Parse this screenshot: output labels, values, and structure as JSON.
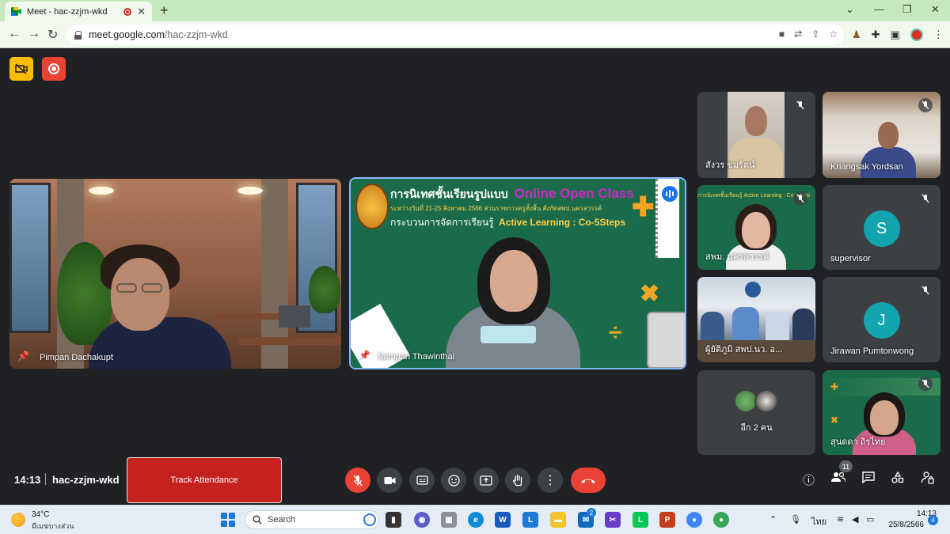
{
  "browser": {
    "tab_title": "Meet - hac-zzjm-wkd",
    "url_host": "meet.google.com",
    "url_path": "/hac-zzjm-wkd"
  },
  "participants": {
    "main_left": {
      "name": "Pimpan Dachakupt"
    },
    "main_center": {
      "name": "Sampan Thawinthai",
      "banner_title_th": "การนิเทศชั้นเรียนรูปแบบ",
      "banner_title_en": "Online Open Class",
      "banner_subtitle_th": "ระหว่างวันที่ 21-25 สิงหาคม 2566 ส่วนราชการครูทั้งสิ้น สังกัดสพป.นครสวรรค์",
      "banner_process_th": "กระบวนการจัดการเรียนรู้",
      "banner_process_en": "Active Learning : Co-5Steps"
    },
    "grid": [
      {
        "name": "สังวร ขมรัตน์",
        "muted": true
      },
      {
        "name": "Kriangsak Yordsan",
        "muted": true
      },
      {
        "name": "สพม. นครสวรรค์",
        "muted": true,
        "banner_text": "การนิเทศชั้นเรียนรู้ Active Learning : Co-5Step"
      },
      {
        "name": "supervisor",
        "initial": "S",
        "avatar_color": "#12a4af",
        "muted": true
      },
      {
        "name": "ผู้ยัติภูมิ สพป.นว. อ...",
        "muted": false
      },
      {
        "name": "Jirawan Pumtonwong",
        "initial": "J",
        "avatar_color": "#12a4af",
        "muted": true
      },
      {
        "name": "อีก 2 คน"
      },
      {
        "name": "สุนดดา ถิรไทย",
        "muted": true
      }
    ]
  },
  "bottom_bar": {
    "time": "14:13",
    "meeting_code": "hac-zzjm-wkd",
    "track_attendance": "Track Attendance",
    "people_count": "11"
  },
  "taskbar": {
    "temperature": "34°C",
    "condition": "มีเมฆบางส่วน",
    "search_label": "Search",
    "mail_badge": "2",
    "language": "ไทย",
    "time": "14:13",
    "date": "25/8/2566",
    "notification_count": "4"
  },
  "colors": {
    "meet_bg": "#202124",
    "tab_strip": "#c7e9c0",
    "active_speaker_border": "#8ab4f8",
    "danger": "#ea4335",
    "avatar_teal": "#12a4af"
  }
}
